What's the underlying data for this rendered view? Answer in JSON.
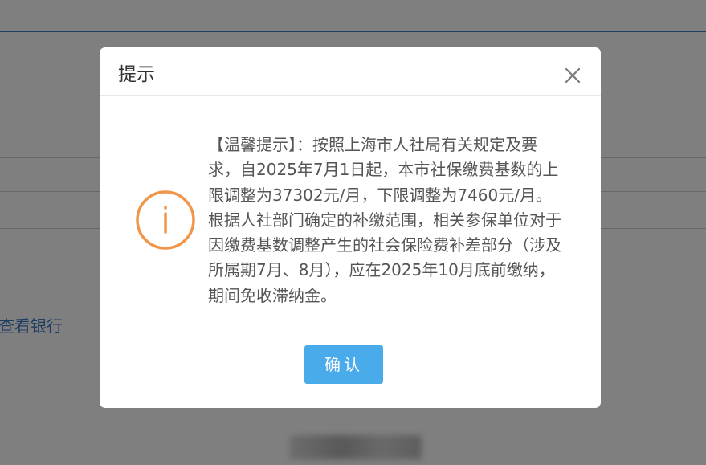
{
  "background_page": {
    "link_text": "查看银行"
  },
  "dialog": {
    "title": "提示",
    "message": "【温馨提示】：按照上海市人社局有关规定及要求，自2025年7月1日起，本市社保缴费基数的上限调整为37302元/月，下限调整为7460元/月。根据人社部门确定的补缴范围，相关参保单位对于因缴费基数调整产生的社会保险费补差部分（涉及所属期7月、8月），应在2025年10月底前缴纳，期间免收滞纳金。",
    "confirm_label": "确认",
    "icons": {
      "close": "close-icon",
      "warning": "info-circle-icon"
    }
  },
  "colors": {
    "overlay": "rgba(0,0,0,0.5)",
    "icon_orange": "#f0954a",
    "button_blue": "#4aabea",
    "link_blue": "#3a78c4"
  }
}
